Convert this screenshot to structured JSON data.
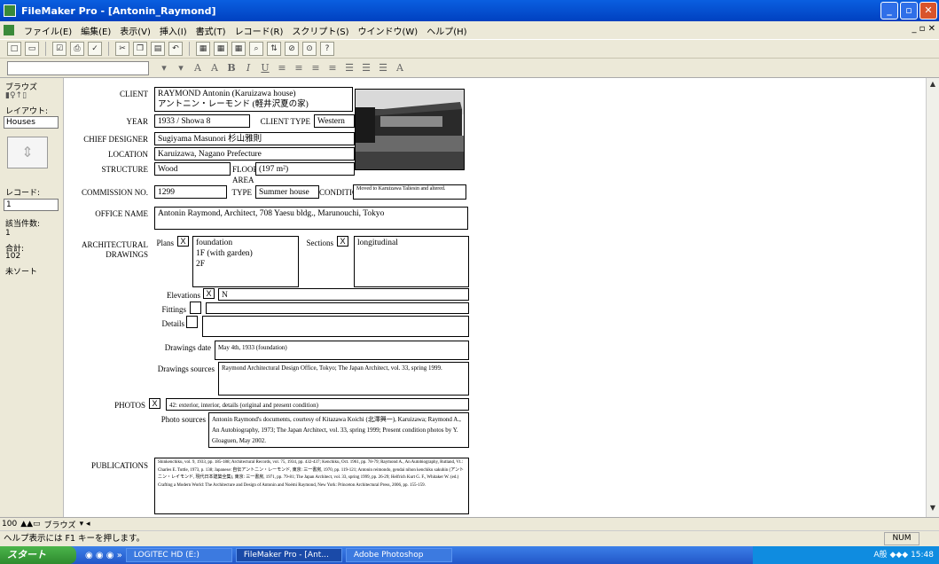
{
  "window": {
    "title": "FileMaker Pro - [Antonin_Raymond]"
  },
  "menubar": {
    "items": [
      "ファイル(E)",
      "編集(E)",
      "表示(V)",
      "挿入(I)",
      "書式(T)",
      "レコード(R)",
      "スクリプト(S)",
      "ウインドウ(W)",
      "ヘルプ(H)"
    ]
  },
  "statusarea": {
    "mode_label": "ブラウズ",
    "layout_label": "レイアウト:",
    "layout_value": "Houses",
    "record_label": "レコード:",
    "record_value": "1",
    "found_label": "該当件数:",
    "found_value": "1",
    "total_label": "合計:",
    "total_value": "102",
    "sort_label": "未ソート"
  },
  "record": {
    "client_label": "CLIENT",
    "client_value_1": "RAYMOND Antonin (Karuizawa house)",
    "client_value_2": "アントニン・レーモンド (軽井沢夏の家)",
    "year_label": "YEAR",
    "year_value": "1933 / Showa 8",
    "client_type_label": "CLIENT TYPE",
    "client_type_value": "Western",
    "chief_designer_label": "CHIEF DESIGNER",
    "chief_designer_value": "Sugiyama Masunori  杉山雅則",
    "location_label": "LOCATION",
    "location_value": "Karuizawa, Nagano Prefecture",
    "structure_label": "STRUCTURE",
    "structure_value": "Wood",
    "floor_area_label_1": "FLOOR",
    "floor_area_label_2": "AREA",
    "floor_area_value": "(197 m²)",
    "commission_label": "COMMISSION NO.",
    "commission_value": "1299",
    "type_label": "TYPE",
    "type_value": "Summer house",
    "condition_label": "CONDITION",
    "condition_value": "Moved to Karuizawa Taliesin and altered.",
    "office_name_label": "OFFICE NAME",
    "office_name_value": "Antonin Raymond, Architect, 708 Yaesu bldg., Marunouchi, Tokyo",
    "arch_drawings_label_1": "ARCHITECTURAL",
    "arch_drawings_label_2": "DRAWINGS",
    "plans_label": "Plans",
    "plans_check": "X",
    "plans_value_1": "foundation",
    "plans_value_2": "1F (with garden)",
    "plans_value_3": "2F",
    "sections_label": "Sections",
    "sections_check": "X",
    "sections_value": "longitudinal",
    "elevations_label": "Elevations",
    "elevations_check": "X",
    "elevations_value": "N",
    "fittings_label": "Fittings",
    "details_label": "Details",
    "drawings_date_label": "Drawings date",
    "drawings_date_value": "May 4th, 1933 (foundation)",
    "drawings_sources_label": "Drawings sources",
    "drawings_sources_value": "Raymond Architectural Design Office, Tokyo; The Japan Architect, vol. 33, spring 1999.",
    "photos_label": "PHOTOS",
    "photos_check": "X",
    "photos_value": "42: exterior, interior, details (original and present condition)",
    "photo_sources_label": "Photo sources",
    "photo_sources_value": "Antonin Raymond's documents, courtesy of Kitazawa Koichi (北澤興一), Karuizawa; Raymond A., An Autobiography, 1973; The Japan Architect, vol. 33, spring 1999; Present condition photos by Y. Gloaguen, May 2002.",
    "publications_label": "PUBLICATIONS",
    "publications_value": "Shinkenchiku, vol. 9, 1933, pp. 185-188; Architectural Records, vol. 75, 1934, pp. 432-437; Kenchiku, Oct. 1961, pp. 78-79; Raymond A., An Autobiography, Rutland, Vt.: Charles E. Tuttle, 1973, p. 138; Japanese: 自伝アントニン・レーモンド, 東京: 三一書房, 1970, pp. 119-121; Antonin reimondo, gendai nihon kenchiku sakuhin (アントニン・レイモンド, 現代日本建築全集), 東京: 三一書房, 1971, pp. 79-81; The Japan Architect, vol. 33, spring 1999, pp. 26-29; Helfrich Kurt G. F., Whitaker W. (ed.) Crafting a Modern World: The Architecture and Design of Antonin and Noémi Raymond, New York: Princeton Architectural Press, 2006, pp. 155-159."
  },
  "bottombar": {
    "zoom": "100",
    "mode": "ブラウズ"
  },
  "helpbar": {
    "text": "ヘルプ表示には F1 キーを押します。",
    "num": "NUM"
  },
  "taskbar": {
    "start": "スタート",
    "items": [
      "LOGITEC HD (E:)",
      "FileMaker Pro - [Ant...",
      "Adobe Photoshop"
    ],
    "tray_text": "A般",
    "clock": "15:48"
  }
}
